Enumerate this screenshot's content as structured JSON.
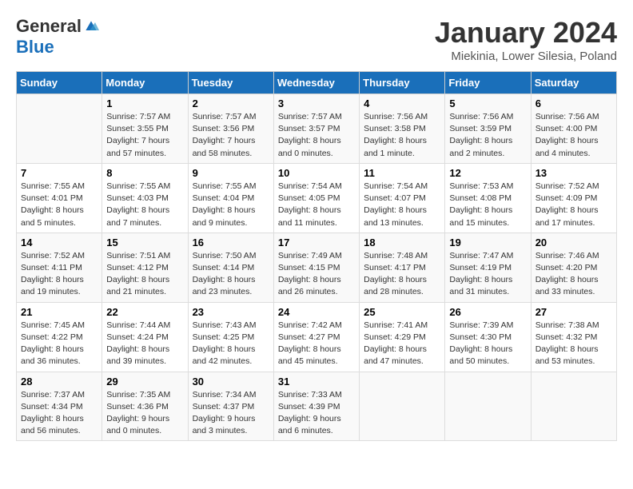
{
  "header": {
    "logo_general": "General",
    "logo_blue": "Blue",
    "title": "January 2024",
    "subtitle": "Miekinia, Lower Silesia, Poland"
  },
  "days_of_week": [
    "Sunday",
    "Monday",
    "Tuesday",
    "Wednesday",
    "Thursday",
    "Friday",
    "Saturday"
  ],
  "weeks": [
    [
      {
        "num": "",
        "info": ""
      },
      {
        "num": "1",
        "info": "Sunrise: 7:57 AM\nSunset: 3:55 PM\nDaylight: 7 hours\nand 57 minutes."
      },
      {
        "num": "2",
        "info": "Sunrise: 7:57 AM\nSunset: 3:56 PM\nDaylight: 7 hours\nand 58 minutes."
      },
      {
        "num": "3",
        "info": "Sunrise: 7:57 AM\nSunset: 3:57 PM\nDaylight: 8 hours\nand 0 minutes."
      },
      {
        "num": "4",
        "info": "Sunrise: 7:56 AM\nSunset: 3:58 PM\nDaylight: 8 hours\nand 1 minute."
      },
      {
        "num": "5",
        "info": "Sunrise: 7:56 AM\nSunset: 3:59 PM\nDaylight: 8 hours\nand 2 minutes."
      },
      {
        "num": "6",
        "info": "Sunrise: 7:56 AM\nSunset: 4:00 PM\nDaylight: 8 hours\nand 4 minutes."
      }
    ],
    [
      {
        "num": "7",
        "info": "Sunrise: 7:55 AM\nSunset: 4:01 PM\nDaylight: 8 hours\nand 5 minutes."
      },
      {
        "num": "8",
        "info": "Sunrise: 7:55 AM\nSunset: 4:03 PM\nDaylight: 8 hours\nand 7 minutes."
      },
      {
        "num": "9",
        "info": "Sunrise: 7:55 AM\nSunset: 4:04 PM\nDaylight: 8 hours\nand 9 minutes."
      },
      {
        "num": "10",
        "info": "Sunrise: 7:54 AM\nSunset: 4:05 PM\nDaylight: 8 hours\nand 11 minutes."
      },
      {
        "num": "11",
        "info": "Sunrise: 7:54 AM\nSunset: 4:07 PM\nDaylight: 8 hours\nand 13 minutes."
      },
      {
        "num": "12",
        "info": "Sunrise: 7:53 AM\nSunset: 4:08 PM\nDaylight: 8 hours\nand 15 minutes."
      },
      {
        "num": "13",
        "info": "Sunrise: 7:52 AM\nSunset: 4:09 PM\nDaylight: 8 hours\nand 17 minutes."
      }
    ],
    [
      {
        "num": "14",
        "info": "Sunrise: 7:52 AM\nSunset: 4:11 PM\nDaylight: 8 hours\nand 19 minutes."
      },
      {
        "num": "15",
        "info": "Sunrise: 7:51 AM\nSunset: 4:12 PM\nDaylight: 8 hours\nand 21 minutes."
      },
      {
        "num": "16",
        "info": "Sunrise: 7:50 AM\nSunset: 4:14 PM\nDaylight: 8 hours\nand 23 minutes."
      },
      {
        "num": "17",
        "info": "Sunrise: 7:49 AM\nSunset: 4:15 PM\nDaylight: 8 hours\nand 26 minutes."
      },
      {
        "num": "18",
        "info": "Sunrise: 7:48 AM\nSunset: 4:17 PM\nDaylight: 8 hours\nand 28 minutes."
      },
      {
        "num": "19",
        "info": "Sunrise: 7:47 AM\nSunset: 4:19 PM\nDaylight: 8 hours\nand 31 minutes."
      },
      {
        "num": "20",
        "info": "Sunrise: 7:46 AM\nSunset: 4:20 PM\nDaylight: 8 hours\nand 33 minutes."
      }
    ],
    [
      {
        "num": "21",
        "info": "Sunrise: 7:45 AM\nSunset: 4:22 PM\nDaylight: 8 hours\nand 36 minutes."
      },
      {
        "num": "22",
        "info": "Sunrise: 7:44 AM\nSunset: 4:24 PM\nDaylight: 8 hours\nand 39 minutes."
      },
      {
        "num": "23",
        "info": "Sunrise: 7:43 AM\nSunset: 4:25 PM\nDaylight: 8 hours\nand 42 minutes."
      },
      {
        "num": "24",
        "info": "Sunrise: 7:42 AM\nSunset: 4:27 PM\nDaylight: 8 hours\nand 45 minutes."
      },
      {
        "num": "25",
        "info": "Sunrise: 7:41 AM\nSunset: 4:29 PM\nDaylight: 8 hours\nand 47 minutes."
      },
      {
        "num": "26",
        "info": "Sunrise: 7:39 AM\nSunset: 4:30 PM\nDaylight: 8 hours\nand 50 minutes."
      },
      {
        "num": "27",
        "info": "Sunrise: 7:38 AM\nSunset: 4:32 PM\nDaylight: 8 hours\nand 53 minutes."
      }
    ],
    [
      {
        "num": "28",
        "info": "Sunrise: 7:37 AM\nSunset: 4:34 PM\nDaylight: 8 hours\nand 56 minutes."
      },
      {
        "num": "29",
        "info": "Sunrise: 7:35 AM\nSunset: 4:36 PM\nDaylight: 9 hours\nand 0 minutes."
      },
      {
        "num": "30",
        "info": "Sunrise: 7:34 AM\nSunset: 4:37 PM\nDaylight: 9 hours\nand 3 minutes."
      },
      {
        "num": "31",
        "info": "Sunrise: 7:33 AM\nSunset: 4:39 PM\nDaylight: 9 hours\nand 6 minutes."
      },
      {
        "num": "",
        "info": ""
      },
      {
        "num": "",
        "info": ""
      },
      {
        "num": "",
        "info": ""
      }
    ]
  ]
}
